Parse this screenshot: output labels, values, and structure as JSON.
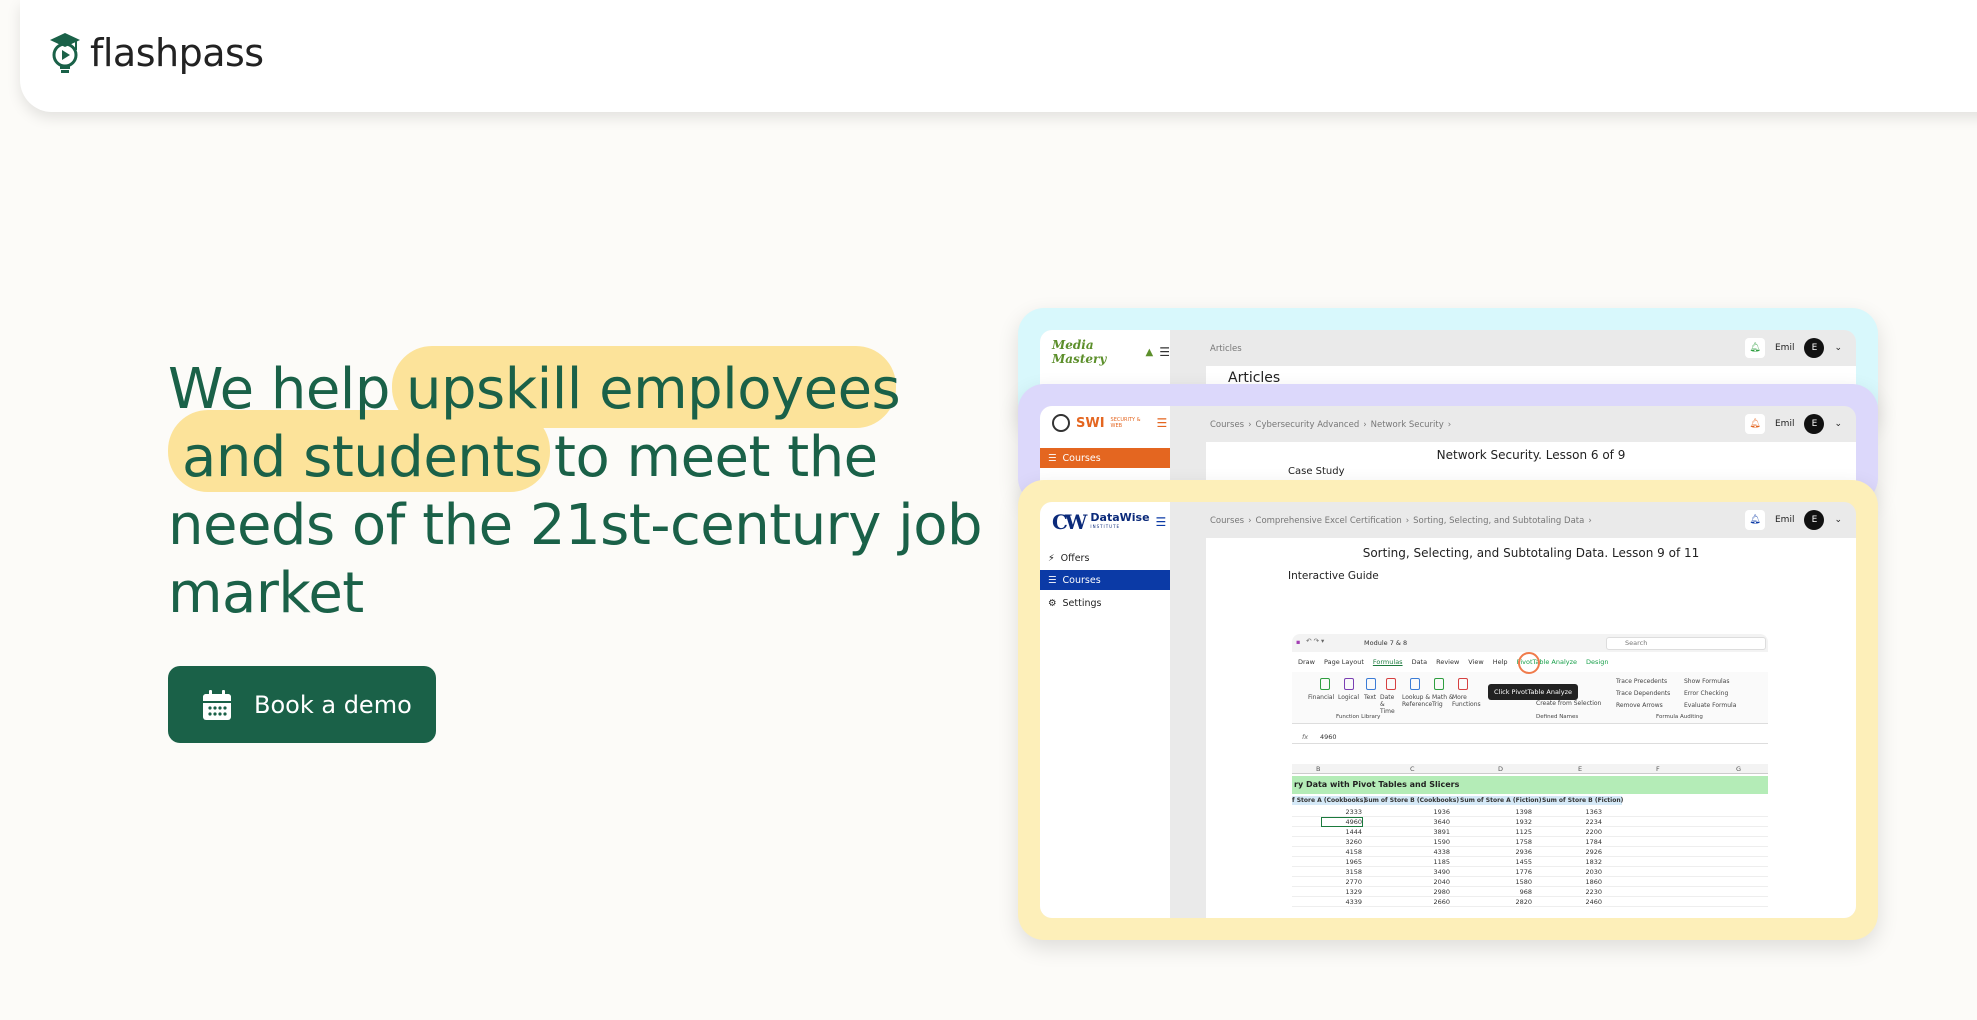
{
  "brand": {
    "name": "flashpass"
  },
  "hero": {
    "lines": [
      [
        "We help ",
        "upskill employees"
      ],
      [
        "and students ",
        "to meet the"
      ],
      [
        "needs of the 21st-century job"
      ],
      [
        "market"
      ]
    ],
    "line1_plain": "We help",
    "line1_hl": "upskill employees",
    "line2_hl": "and students",
    "line2_plain": "to meet the",
    "line3": "needs of the 21st-century job",
    "line4": "market",
    "cta_label": "Book a demo"
  },
  "colors": {
    "primary": "#1a6148",
    "highlight": "#fce39a",
    "card1": "#d8f8fc",
    "card2": "#dcd8fb",
    "card3": "#fdefb9"
  },
  "card1": {
    "brand": "Media Mastery",
    "crumb": "Articles",
    "heading": "Articles",
    "user": "Emil",
    "avatar": "E"
  },
  "card2": {
    "brand": "SWI",
    "brand_sub": "SECURITY & WEB",
    "crumbs": [
      "Courses",
      "Cybersecurity Advanced",
      "Network Security"
    ],
    "nav_courses": "Courses",
    "lesson_title": "Network Security. Lesson 6 of 9",
    "sub": "Case Study",
    "user": "Emil",
    "avatar": "E"
  },
  "card3": {
    "brand": "DataWise",
    "brand_sub": "INSTITUTE",
    "crumbs": [
      "Courses",
      "Comprehensive Excel Certification",
      "Sorting, Selecting, and Subtotaling Data"
    ],
    "nav": [
      "Offers",
      "Courses",
      "Settings"
    ],
    "lesson_title": "Sorting, Selecting, and Subtotaling Data. Lesson 9 of 11",
    "guide_label": "Interactive Guide",
    "user": "Emil",
    "avatar": "E",
    "excel": {
      "file": "Module 7 & 8",
      "search": "Search",
      "tabs": [
        "Draw",
        "Page Layout",
        "Formulas",
        "Data",
        "Review",
        "View",
        "Help",
        "PivotTable Analyze",
        "Design"
      ],
      "ribbon": [
        "Financial",
        "Logical",
        "Text",
        "Date & Time",
        "Lookup & Reference",
        "Math & Trig",
        "More Functions"
      ],
      "ribbon_right": [
        "Trace Precedents",
        "Trace Dependents",
        "Remove Arrows",
        "Show Formulas",
        "Error Checking",
        "Evaluate Formula",
        "Create from Selection"
      ],
      "groups": [
        "Function Library",
        "Defined Names",
        "Formula Auditing"
      ],
      "tooltip": "Click PivotTable Analyze",
      "formula_value": "4960",
      "columns": [
        "B",
        "C",
        "D",
        "E",
        "F",
        "G"
      ],
      "sheet_title": "ry Data with Pivot Tables and Slicers",
      "headers": [
        "f Store A (Cookbooks)",
        "Sum of Store B (Cookbooks)",
        "Sum of Store A (Fiction)",
        "Sum of Store B (Fiction)"
      ],
      "rows": [
        [
          "2333",
          "1936",
          "1398",
          "1363"
        ],
        [
          "4960",
          "3640",
          "1932",
          "2234"
        ],
        [
          "1444",
          "3891",
          "1125",
          "2200"
        ],
        [
          "3260",
          "1590",
          "1758",
          "1784"
        ],
        [
          "4158",
          "4338",
          "2936",
          "2926"
        ],
        [
          "1965",
          "1185",
          "1455",
          "1832"
        ],
        [
          "3158",
          "3490",
          "1776",
          "2030"
        ],
        [
          "2770",
          "2040",
          "1580",
          "1860"
        ],
        [
          "1329",
          "2980",
          "968",
          "2230"
        ],
        [
          "4339",
          "2660",
          "2820",
          "2460"
        ]
      ]
    }
  }
}
